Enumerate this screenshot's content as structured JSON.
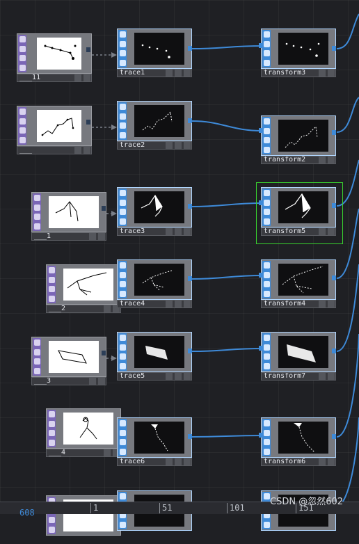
{
  "colors": {
    "background": "#1f2024",
    "wire": "#3e8ad8",
    "top_accent": "#3e8ad8",
    "dat_accent": "#7a66b6",
    "selected_border": "#39d42f"
  },
  "nodes": {
    "dat_11": {
      "label": "___11"
    },
    "dat_blank": {
      "label": "___"
    },
    "dat_1": {
      "label": "___1"
    },
    "dat_2": {
      "label": "___2"
    },
    "dat_3": {
      "label": "___3"
    },
    "dat_4": {
      "label": "___4"
    },
    "trace1": {
      "label": "trace1"
    },
    "trace2": {
      "label": "trace2"
    },
    "trace3": {
      "label": "trace3"
    },
    "trace4": {
      "label": "trace4"
    },
    "trace5": {
      "label": "trace5"
    },
    "trace6": {
      "label": "trace6"
    },
    "transform3": {
      "label": "transform3"
    },
    "transform2": {
      "label": "transform2"
    },
    "transform5": {
      "label": "transform5"
    },
    "transform4": {
      "label": "transform4"
    },
    "transform7": {
      "label": "transform7"
    },
    "transform6": {
      "label": "transform6"
    }
  },
  "timeline": {
    "frame": "608",
    "ticks": [
      "1",
      "51",
      "101",
      "151"
    ]
  },
  "watermark": "CSDN @忽然602",
  "icons": {
    "node_side_buttons": [
      "info-icon",
      "pencil-icon",
      "arrow-icon",
      "viewer-icon"
    ]
  }
}
